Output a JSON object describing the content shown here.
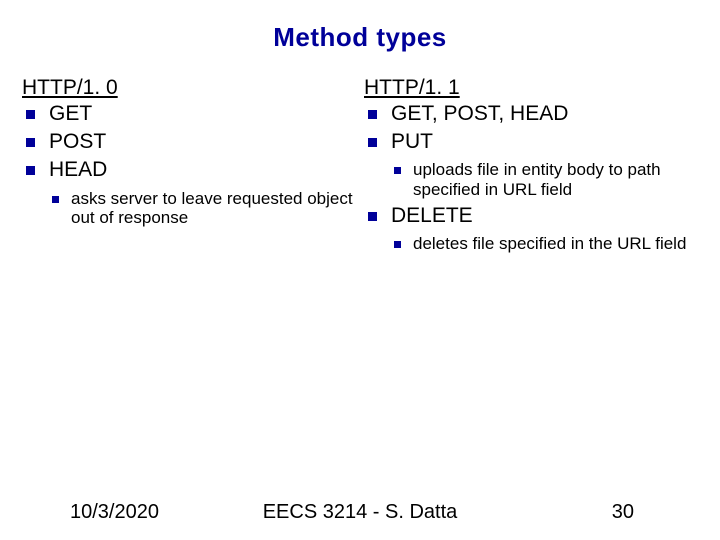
{
  "title": "Method types",
  "left": {
    "heading": "HTTP/1. 0",
    "items": [
      {
        "label": "GET"
      },
      {
        "label": "POST"
      },
      {
        "label": "HEAD",
        "sub": [
          "asks server to leave requested object out of response"
        ]
      }
    ]
  },
  "right": {
    "heading": "HTTP/1. 1",
    "items": [
      {
        "label": "GET, POST, HEAD"
      },
      {
        "label": "PUT",
        "sub": [
          "uploads file in entity body to path specified in URL field"
        ]
      },
      {
        "label": "DELETE",
        "sub": [
          "deletes file specified in the URL field"
        ]
      }
    ]
  },
  "footer": {
    "date": "10/3/2020",
    "course": "EECS 3214 - S. Datta",
    "slide_number": "30"
  }
}
